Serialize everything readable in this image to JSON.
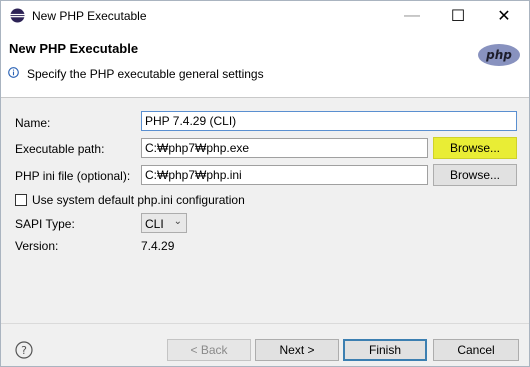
{
  "window": {
    "title": "New PHP Executable",
    "controls": {
      "minimize": "—",
      "maximize": "☐",
      "close": "✕"
    }
  },
  "banner": {
    "title": "New PHP Executable",
    "description": "Specify the PHP executable general settings",
    "logo_text": "php"
  },
  "form": {
    "name_label": "Name:",
    "name_value": "PHP 7.4.29 (CLI)",
    "exec_label": "Executable path:",
    "exec_value": "C:₩php7₩php.exe",
    "exec_browse": "Browse...",
    "ini_label": "PHP ini file (optional):",
    "ini_value": "C:₩php7₩php.ini",
    "ini_browse": "Browse...",
    "use_default_label": "Use system default php.ini configuration",
    "use_default_checked": false,
    "sapi_label": "SAPI Type:",
    "sapi_value": "CLI",
    "version_label": "Version:",
    "version_value": "7.4.29"
  },
  "footer": {
    "back": "< Back",
    "next": "Next >",
    "finish": "Finish",
    "cancel": "Cancel"
  },
  "colors": {
    "highlight": "#e9ed35",
    "default_button_border": "#3c7fb1",
    "php_logo": "#8892bf"
  }
}
